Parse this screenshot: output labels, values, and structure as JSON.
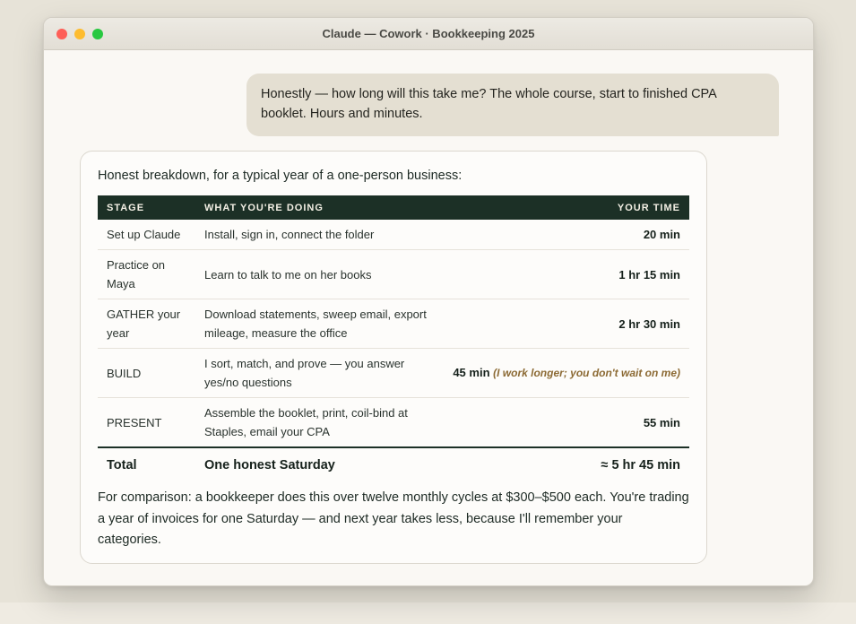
{
  "window": {
    "title": "Claude — Cowork · Bookkeeping 2025"
  },
  "user_message": "Honestly — how long will this take me? The whole course, start to finished CPA booklet. Hours and minutes.",
  "assistant": {
    "intro": "Honest breakdown, for a typical year of a one-person business:",
    "table": {
      "headers": [
        "STAGE",
        "WHAT YOU'RE DOING",
        "YOUR TIME"
      ],
      "rows": [
        {
          "stage": "Set up Claude",
          "doing": "Install, sign in, connect the folder",
          "time": "20 min",
          "note": ""
        },
        {
          "stage": "Practice on Maya",
          "doing": "Learn to talk to me on her books",
          "time": "1 hr 15 min",
          "note": ""
        },
        {
          "stage": "GATHER your year",
          "doing": "Download statements, sweep email, export mileage, measure the office",
          "time": "2 hr 30 min",
          "note": ""
        },
        {
          "stage": "BUILD",
          "doing": "I sort, match, and prove — you answer yes/no questions",
          "time": "45 min",
          "note": "(I work longer; you don't wait on me)"
        },
        {
          "stage": "PRESENT",
          "doing": "Assemble the booklet, print, coil-bind at Staples, email your CPA",
          "time": "55 min",
          "note": ""
        }
      ],
      "total": {
        "label": "Total",
        "doing": "One honest Saturday",
        "time": "≈ 5 hr 45 min"
      }
    },
    "outro": "For comparison: a bookkeeper does this over twelve monthly cycles at $300–$500 each. You're trading a year of invoices for one Saturday — and next year takes less, because I'll remember your categories."
  },
  "colors": {
    "table_header_bg": "#1c3026",
    "note_text": "#8c6a34",
    "user_bubble_bg": "#e4dfd2"
  }
}
